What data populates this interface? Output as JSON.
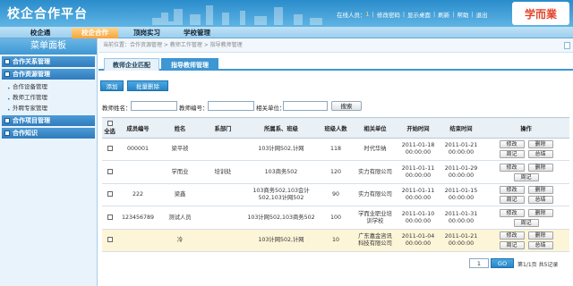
{
  "header": {
    "title": "校企合作平台",
    "user_label": "在线人员：",
    "user_count": "1",
    "links": [
      "修改密码",
      "显示桌面",
      "刷新",
      "帮助",
      "退出"
    ],
    "logo": "学而業"
  },
  "nav": {
    "tabs": [
      "校企通",
      "校企合作",
      "顶岗实习",
      "学校管理"
    ],
    "active_index": 1
  },
  "sidebar": {
    "title": "菜单面板",
    "categories": [
      {
        "label": "合作关系管理",
        "sub": []
      },
      {
        "label": "合作资源管理",
        "sub": [
          "合作设备管理",
          "教师工作管理",
          "外聘专家管理"
        ]
      },
      {
        "label": "合作项目管理",
        "sub": []
      },
      {
        "label": "合作知识",
        "sub": []
      }
    ]
  },
  "breadcrumb": "当前位置：合作资源管理 > 教师工作管理 > 指导教师管理",
  "subtabs": [
    "教师企业匹配",
    "指导教师管理"
  ],
  "subtab_active": 1,
  "actions": {
    "add": "添加",
    "batch_delete": "批量删除"
  },
  "search": {
    "teacher_name": "教师姓名：",
    "teacher_no": "教师编号：",
    "unit": "相关单位：",
    "button": "搜索"
  },
  "table": {
    "headers": [
      "全选",
      "成员编号",
      "姓名",
      "系部门",
      "所属系、班级",
      "班级人数",
      "相关单位",
      "开始时间",
      "结束时间",
      "操作"
    ],
    "rows": [
      {
        "id": "000001",
        "name": "梁平祯",
        "dept": "",
        "class": "103计网502,计网",
        "count": "118",
        "unit": "时代华纳",
        "start": "2011-01-18\n00:00:00",
        "end": "2011-01-21\n00:00:00",
        "ops": [
          "修改",
          "删除",
          "周记",
          "总结"
        ]
      },
      {
        "id": "",
        "name": "学而业",
        "dept": "培训处",
        "class": "103商务502",
        "count": "120",
        "unit": "实力有限公司",
        "start": "2011-01-11\n00:00:00",
        "end": "2011-01-29\n00:00:00",
        "ops": [
          "修改",
          "删除",
          "周记"
        ]
      },
      {
        "id": "222",
        "name": "梁鑫",
        "dept": "",
        "class": "103商务502,103会计502,103计网502",
        "count": "90",
        "unit": "实力有限公司",
        "start": "2011-01-11\n00:00:00",
        "end": "2011-01-15\n00:00:00",
        "ops": [
          "修改",
          "删除",
          "周记",
          "总结"
        ]
      },
      {
        "id": "123456789",
        "name": "测试人员",
        "dept": "",
        "class": "103计网502,103商务502",
        "count": "100",
        "unit": "学而业职业培\n训学校",
        "start": "2011-01-10\n00:00:00",
        "end": "2011-01-31\n00:00:00",
        "ops": [
          "修改",
          "删除",
          "周记"
        ]
      },
      {
        "id": "",
        "name": "冷",
        "dept": "",
        "class": "103计网502,计网",
        "count": "10",
        "unit": "广东嘉金咨讯\n科技有限公司",
        "start": "2011-01-04\n00:00:00",
        "end": "2011-01-21\n00:00:00",
        "ops": [
          "修改",
          "删除",
          "周记",
          "总结"
        ],
        "highlight": true
      }
    ]
  },
  "pager": {
    "page_value": "1",
    "go": "GO",
    "info": "第1/1页 共5记录"
  },
  "colors": {
    "header": "#2a8ccb",
    "accent": "#3e96d2",
    "nav_active": "#f5a43c",
    "row_highlight": "#fdf5d8"
  }
}
